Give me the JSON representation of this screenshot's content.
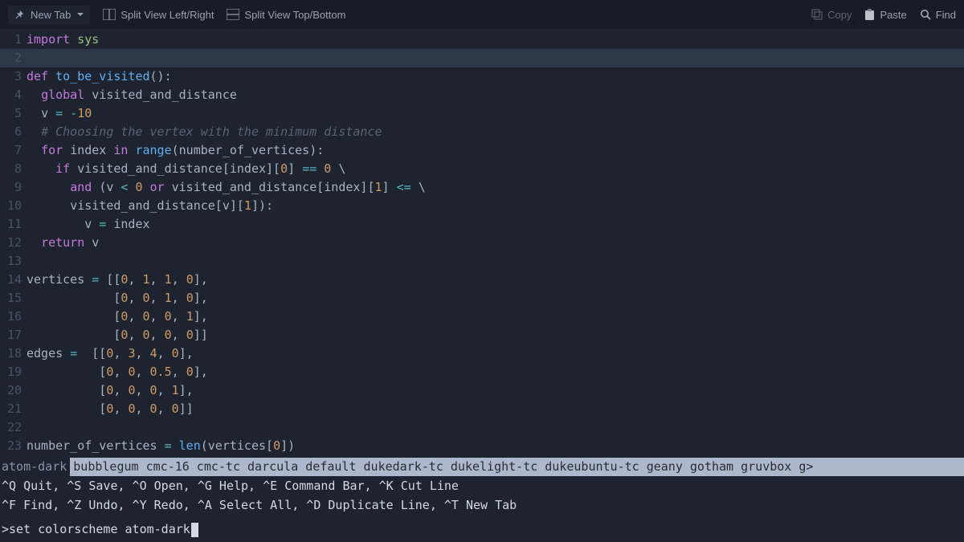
{
  "toolbar": {
    "tab_label": "New Tab",
    "split_lr": "Split View Left/Right",
    "split_tb": "Split View Top/Bottom",
    "copy": "Copy",
    "paste": "Paste",
    "find": "Find"
  },
  "code": {
    "lines": [
      {
        "n": 1,
        "html": "<span class='k'>import</span> <span class='s'>sys</span>"
      },
      {
        "n": 2,
        "html": "",
        "hl": true
      },
      {
        "n": 3,
        "html": "<span class='k'>def</span> <span class='fn'>to_be_visited</span><span class='p'>():</span>"
      },
      {
        "n": 4,
        "html": "  <span class='k'>global</span> <span class='p'>visited_and_distance</span>"
      },
      {
        "n": 5,
        "html": "  <span class='p'>v</span> <span class='o'>=</span> <span class='o'>-</span><span class='n'>10</span>"
      },
      {
        "n": 6,
        "html": "  <span class='c'># Choosing the vertex with the minimum distance</span>"
      },
      {
        "n": 7,
        "html": "  <span class='k'>for</span> <span class='p'>index</span> <span class='k'>in</span> <span class='fn'>range</span><span class='p'>(number_of_vertices):</span>"
      },
      {
        "n": 8,
        "html": "    <span class='k'>if</span> <span class='p'>visited_and_distance[index][</span><span class='n'>0</span><span class='p'>]</span> <span class='o'>==</span> <span class='n'>0</span> <span class='p'>\\</span>"
      },
      {
        "n": 9,
        "html": "      <span class='k'>and</span> <span class='p'>(v</span> <span class='o'>&lt;</span> <span class='n'>0</span> <span class='k'>or</span> <span class='p'>visited_and_distance[index][</span><span class='n'>1</span><span class='p'>]</span> <span class='o'>&lt;=</span> <span class='p'>\\</span>"
      },
      {
        "n": 10,
        "html": "      <span class='p'>visited_and_distance[v][</span><span class='n'>1</span><span class='p'>]):</span>"
      },
      {
        "n": 11,
        "html": "        <span class='p'>v</span> <span class='o'>=</span> <span class='p'>index</span>"
      },
      {
        "n": 12,
        "html": "  <span class='k'>return</span> <span class='p'>v</span>"
      },
      {
        "n": 13,
        "html": ""
      },
      {
        "n": 14,
        "html": "<span class='p'>vertices</span> <span class='o'>=</span> <span class='p'>[[</span><span class='n'>0</span><span class='p'>, </span><span class='n'>1</span><span class='p'>, </span><span class='n'>1</span><span class='p'>, </span><span class='n'>0</span><span class='p'>],</span>"
      },
      {
        "n": 15,
        "html": "            <span class='p'>[</span><span class='n'>0</span><span class='p'>, </span><span class='n'>0</span><span class='p'>, </span><span class='n'>1</span><span class='p'>, </span><span class='n'>0</span><span class='p'>],</span>"
      },
      {
        "n": 16,
        "html": "            <span class='p'>[</span><span class='n'>0</span><span class='p'>, </span><span class='n'>0</span><span class='p'>, </span><span class='n'>0</span><span class='p'>, </span><span class='n'>1</span><span class='p'>],</span>"
      },
      {
        "n": 17,
        "html": "            <span class='p'>[</span><span class='n'>0</span><span class='p'>, </span><span class='n'>0</span><span class='p'>, </span><span class='n'>0</span><span class='p'>, </span><span class='n'>0</span><span class='p'>]]</span>"
      },
      {
        "n": 18,
        "html": "<span class='p'>edges</span> <span class='o'>=</span>  <span class='p'>[[</span><span class='n'>0</span><span class='p'>, </span><span class='n'>3</span><span class='p'>, </span><span class='n'>4</span><span class='p'>, </span><span class='n'>0</span><span class='p'>],</span>"
      },
      {
        "n": 19,
        "html": "          <span class='p'>[</span><span class='n'>0</span><span class='p'>, </span><span class='n'>0</span><span class='p'>, </span><span class='n'>0.5</span><span class='p'>, </span><span class='n'>0</span><span class='p'>],</span>"
      },
      {
        "n": 20,
        "html": "          <span class='p'>[</span><span class='n'>0</span><span class='p'>, </span><span class='n'>0</span><span class='p'>, </span><span class='n'>0</span><span class='p'>, </span><span class='n'>1</span><span class='p'>],</span>"
      },
      {
        "n": 21,
        "html": "          <span class='p'>[</span><span class='n'>0</span><span class='p'>, </span><span class='n'>0</span><span class='p'>, </span><span class='n'>0</span><span class='p'>, </span><span class='n'>0</span><span class='p'>]]</span>"
      },
      {
        "n": 22,
        "html": ""
      },
      {
        "n": 23,
        "html": "<span class='p'>number_of_vertices</span> <span class='o'>=</span> <span class='fn'>len</span><span class='p'>(vertices[</span><span class='n'>0</span><span class='p'>])</span>"
      }
    ]
  },
  "schemes": {
    "active": "atom-dark",
    "rest": "bubblegum cmc-16 cmc-tc darcula default dukedark-tc dukelight-tc dukeubuntu-tc geany gotham gruvbox g>"
  },
  "help": {
    "line1": "^Q Quit, ^S Save, ^O Open, ^G Help, ^E Command Bar, ^K Cut Line",
    "line2": "^F Find, ^Z Undo, ^Y Redo, ^A Select All, ^D Duplicate Line, ^T New Tab"
  },
  "cmd": {
    "prompt": "> ",
    "text": "set colorscheme atom-dark"
  }
}
